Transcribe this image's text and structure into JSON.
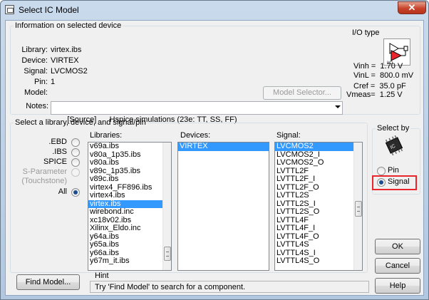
{
  "window": {
    "title": "Select IC Model",
    "close_glyph": "✕"
  },
  "info": {
    "legend": "Information on selected device",
    "library_label": "Library:",
    "library_value": "virtex.ibs",
    "device_label": "Device:",
    "device_value": "VIRTEX",
    "signal_label": "Signal:",
    "signal_value": "LVCMOS2",
    "pin_label": "Pin:",
    "pin_value": "1",
    "model_label": "Model:",
    "model_value": "",
    "model_selector_button": "Model Selector...",
    "notes_label": "Notes:",
    "notes_value": "[Source]      Hspice simulations (23e: TT, SS, FF)"
  },
  "io_type": {
    "label": "I/O type",
    "vinh": "Vinh =  1.70 V",
    "vinl": "VinL =  800.0 mV",
    "cref": "Cref =  35.0 pF",
    "vmeas": "Vmeas=  1.25 V",
    "icon": "io-buffer-icon"
  },
  "select_section": {
    "legend": "Select a library, device, and signal/pin",
    "filters": [
      {
        "label": ".EBD",
        "checked": false,
        "disabled": false
      },
      {
        "label": ".IBS",
        "checked": false,
        "disabled": false
      },
      {
        "label": "SPICE",
        "checked": false,
        "disabled": false
      },
      {
        "label": "S-Parameter",
        "checked": false,
        "disabled": true
      },
      {
        "label": "(Touchstone)",
        "checked": false,
        "disabled": true
      },
      {
        "label": "All",
        "checked": true,
        "disabled": false
      }
    ],
    "libraries_label": "Libraries:",
    "libraries": [
      "v69a.ibs",
      "v80a_1p35.ibs",
      "v80a.ibs",
      "v89c_1p35.ibs",
      "v89c.ibs",
      "virtex4_FF896.ibs",
      "virtex4.ibs",
      "virtex.ibs",
      "wirebond.inc",
      "xc18v02.ibs",
      "Xilinx_Eldo.inc",
      "y64a.ibs",
      "y65a.ibs",
      "y66a.ibs",
      "y67m_it.ibs"
    ],
    "libraries_selected": "virtex.ibs",
    "devices_label": "Devices:",
    "devices": [
      "VIRTEX"
    ],
    "devices_selected": "VIRTEX",
    "signal_label": "Signal:",
    "signals": [
      "LVCMOS2",
      "LVCMOS2_I",
      "LVCMOS2_O",
      "LVTTL2F",
      "LVTTL2F_I",
      "LVTTL2F_O",
      "LVTTL2S",
      "LVTTL2S_I",
      "LVTTL2S_O",
      "LVTTL4F",
      "LVTTL4F_I",
      "LVTTL4F_O",
      "LVTTL4S",
      "LVTTL4S_I",
      "LVTTL4S_O"
    ],
    "signals_selected": "LVCMOS2"
  },
  "select_by": {
    "legend": "Select by",
    "pin_label": "Pin",
    "pin_checked": false,
    "signal_label": "Signal",
    "signal_checked": true,
    "highlight_color": "#e8262c"
  },
  "buttons": {
    "find_model": "Find Model...",
    "ok": "OK",
    "cancel": "Cancel",
    "help": "Help"
  },
  "hint": {
    "label": "Hint",
    "text": "Try 'Find Model' to search for a component."
  },
  "colors": {
    "selection": "#3399ff",
    "title_bar": "#c9daec",
    "close_button": "#c7432a"
  }
}
